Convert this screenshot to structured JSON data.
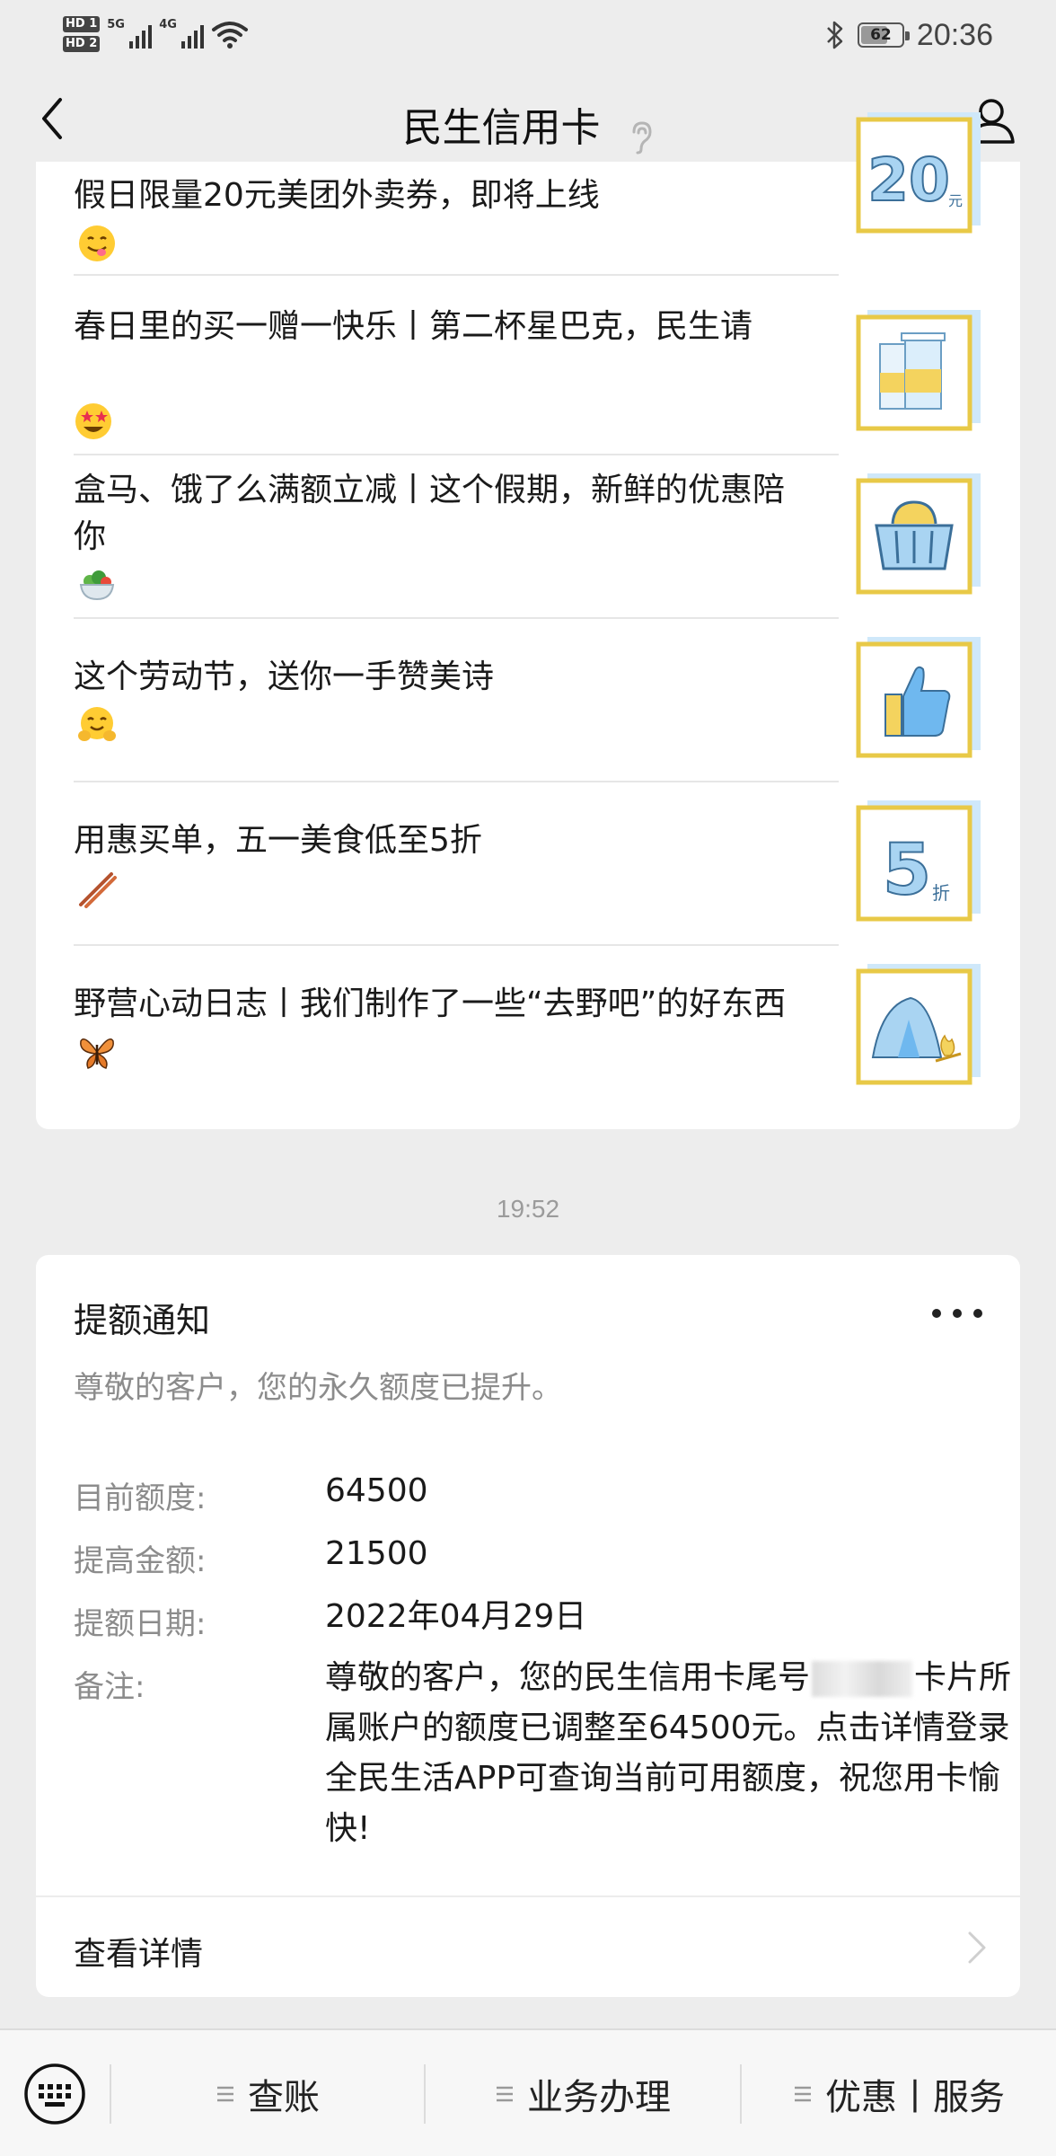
{
  "status_bar": {
    "hd1": "HD 1",
    "hd2": "HD 2",
    "net1": "5G",
    "net2": "4G",
    "battery": "62",
    "time": "20:36"
  },
  "nav": {
    "title": "民生信用卡"
  },
  "articles": [
    {
      "title": "假日限量20元美团外卖券，即将上线",
      "emoji": "savoring-face",
      "thumb": "20-yuan-coupon",
      "thumb_text": "20",
      "thumb_sub": "元"
    },
    {
      "title": "春日里的买一赠一快乐丨第二杯星巴克，民生请",
      "emoji": "star-eyes-face",
      "thumb": "coffee-cups"
    },
    {
      "title": "盒马、饿了么满额立减丨这个假期，新鲜的优惠陪你",
      "emoji": "salad-bowl",
      "thumb": "shopping-basket"
    },
    {
      "title": "这个劳动节，送你一手赞美诗",
      "emoji": "hugging-face",
      "thumb": "thumbs-up"
    },
    {
      "title": "用惠买单，五一美食低至5折",
      "emoji": "chopsticks",
      "thumb": "5-discount",
      "thumb_text": "5",
      "thumb_sub": "折"
    },
    {
      "title": "野营心动日志丨我们制作了一些“去野吧”的好东西",
      "emoji": "butterfly",
      "thumb": "camping-tent"
    }
  ],
  "timestamp": "19:52",
  "notification": {
    "title": "提额通知",
    "subtitle": "尊敬的客户，您的永久额度已提升。",
    "fields": {
      "current_limit_label": "目前额度:",
      "current_limit_value": "64500",
      "increase_label": "提高金额:",
      "increase_value": "21500",
      "date_label": "提额日期:",
      "date_value": "2022年04月29日",
      "note_label": "备注:",
      "note_part1": "尊敬的客户，您的民生信用卡尾号",
      "note_part2": "卡片所属账户的额度已调整至64500元。点击详情登录全民生活APP可查询当前可用额度，祝您用卡愉快!"
    },
    "detail_link": "查看详情"
  },
  "bottom_menu": {
    "items": [
      "查账",
      "业务办理",
      "优惠丨服务"
    ]
  },
  "colors": {
    "thumb_border": "#e8c947",
    "thumb_blue": "#a9d4f2"
  }
}
